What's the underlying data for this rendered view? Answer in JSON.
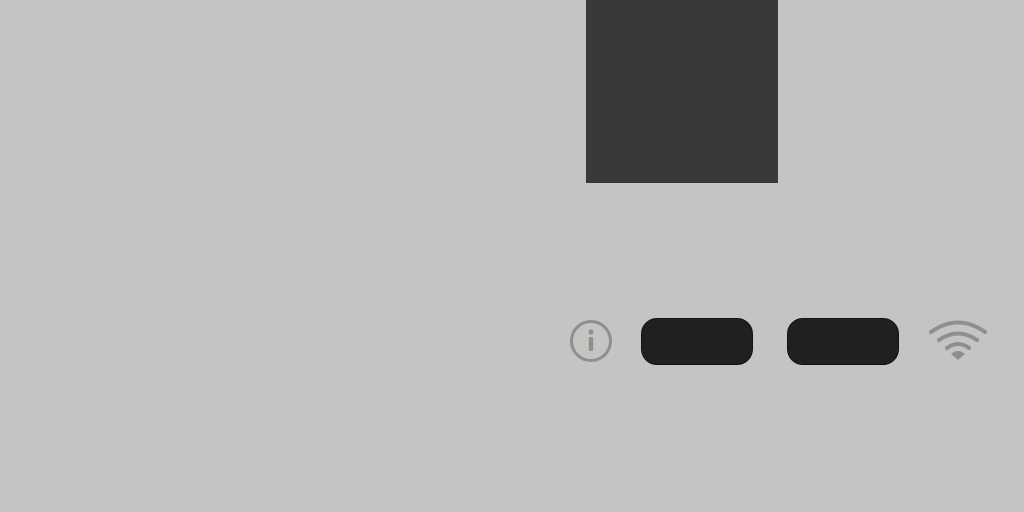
{
  "colors": {
    "background": "#c5c4c2",
    "panel": "#393938",
    "pill": "#202020",
    "icon": "#8f8f8e"
  },
  "icons": {
    "info": "info-icon",
    "wifi": "wifi-icon"
  },
  "buttons": [
    {
      "name": "pill-button-1",
      "label": ""
    },
    {
      "name": "pill-button-2",
      "label": ""
    }
  ]
}
